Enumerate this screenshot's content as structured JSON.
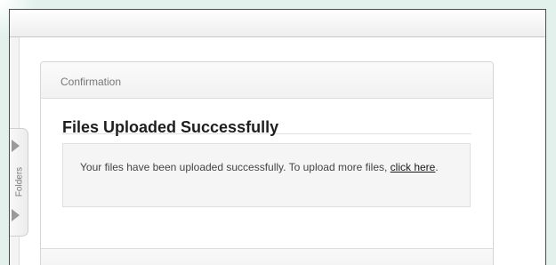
{
  "sidebar": {
    "folders_label": "Folders"
  },
  "card": {
    "header_title": "Confirmation",
    "heading": "Files Uploaded Successfully",
    "message_text": "Your files have been uploaded successfully. To upload more files, ",
    "link_text": "click here",
    "message_end": "."
  }
}
